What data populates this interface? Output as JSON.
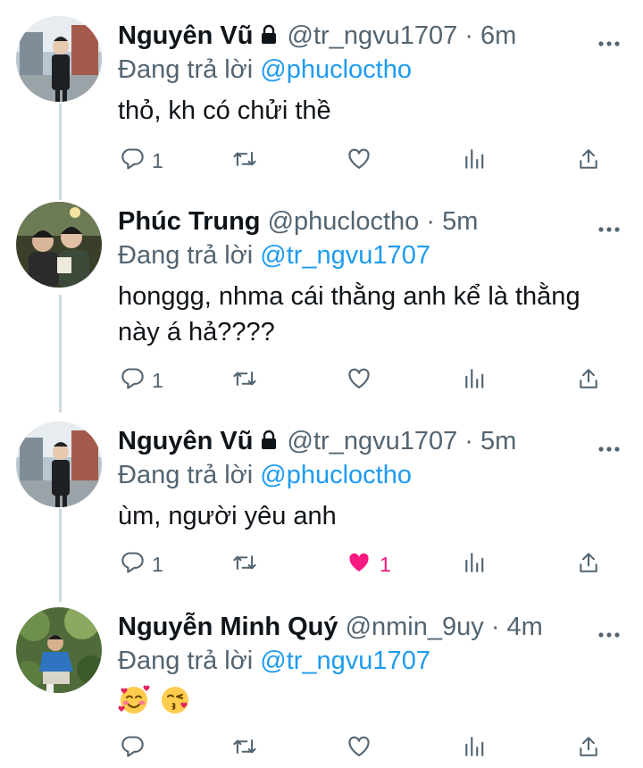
{
  "tweets": [
    {
      "name": "Nguyên Vũ",
      "locked": true,
      "handle": "@tr_ngvu1707",
      "separator": "·",
      "time": "6m",
      "reply_prefix": "Đang trả lời",
      "reply_to": "@phucloctho",
      "text": "thỏ, kh có chửi thề",
      "reply_count": "1",
      "like_count": "",
      "liked": false
    },
    {
      "name": "Phúc Trung",
      "locked": false,
      "handle": "@phucloctho",
      "separator": "·",
      "time": "5m",
      "reply_prefix": "Đang trả lời",
      "reply_to": "@tr_ngvu1707",
      "text": "honggg, nhma cái thằng anh kể là thằng này á hả????",
      "reply_count": "1",
      "like_count": "",
      "liked": false
    },
    {
      "name": "Nguyên Vũ",
      "locked": true,
      "handle": "@tr_ngvu1707",
      "separator": "·",
      "time": "5m",
      "reply_prefix": "Đang trả lời",
      "reply_to": "@phucloctho",
      "text": "ùm, người yêu anh",
      "reply_count": "1",
      "like_count": "1",
      "liked": true
    },
    {
      "name": "Nguyễn Minh Quý",
      "locked": false,
      "handle": "@nmin_9uy",
      "separator": "·",
      "time": "4m",
      "reply_prefix": "Đang trả lời",
      "reply_to": "@tr_ngvu1707",
      "text": "",
      "reply_count": "",
      "like_count": "",
      "liked": false
    }
  ],
  "icons": {
    "more": "more-horizontal-icon",
    "reply": "reply-bubble-icon",
    "retweet": "retweet-icon",
    "like": "heart-icon",
    "views": "analytics-bars-icon",
    "share": "share-upload-icon"
  },
  "colors": {
    "text": "#0f1419",
    "secondary": "#536471",
    "mention": "#1d9bf0",
    "like": "#f91880",
    "thread_line": "#cfd9de"
  }
}
